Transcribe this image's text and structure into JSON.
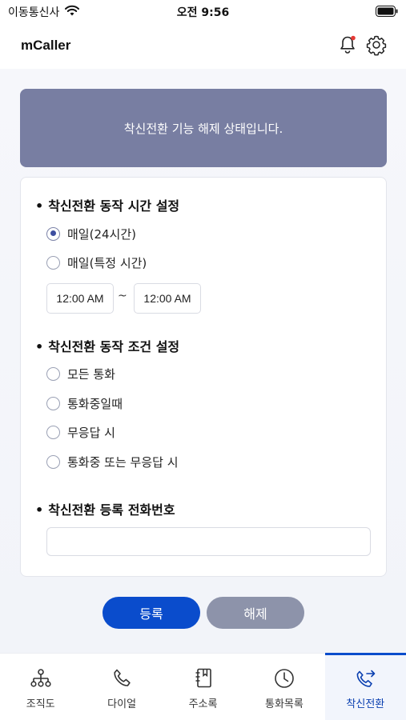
{
  "status_bar": {
    "carrier": "이동통신사",
    "time": "오전 9:56"
  },
  "header": {
    "title": "mCaller",
    "icons": [
      "bell-icon",
      "gear-icon"
    ],
    "notification_dot_color": "#e53935"
  },
  "banner": {
    "text": "착신전환 기능 해제 상태입니다.",
    "color": "#787ea2"
  },
  "time_section": {
    "title": "착신전환 동작 시간 설정",
    "options": [
      {
        "label": "매일(24시간)",
        "checked": true
      },
      {
        "label": "매일(특정 시간)",
        "checked": false
      }
    ],
    "start_time": "12:00 AM",
    "separator": "~",
    "end_time": "12:00 AM"
  },
  "condition_section": {
    "title": "착신전환 동작 조건 설정",
    "options": [
      {
        "label": "모든 통화",
        "checked": false
      },
      {
        "label": "통화중일때",
        "checked": false
      },
      {
        "label": "무응답 시",
        "checked": false
      },
      {
        "label": "통화중 또는 무응답 시",
        "checked": false
      }
    ]
  },
  "phone_section": {
    "title": "착신전환 등록 전화번호",
    "value": "",
    "placeholder": ""
  },
  "actions": {
    "register_label": "등록",
    "release_label": "해제",
    "register_color": "#0a4ccc",
    "release_color": "#8d93aa"
  },
  "tabs": [
    {
      "label": "조직도",
      "icon": "org-chart-icon",
      "active": false
    },
    {
      "label": "다이얼",
      "icon": "phone-icon",
      "active": false
    },
    {
      "label": "주소록",
      "icon": "address-book-icon",
      "active": false
    },
    {
      "label": "통화목록",
      "icon": "clock-icon",
      "active": false
    },
    {
      "label": "착신전환",
      "icon": "call-forward-icon",
      "active": true
    }
  ]
}
